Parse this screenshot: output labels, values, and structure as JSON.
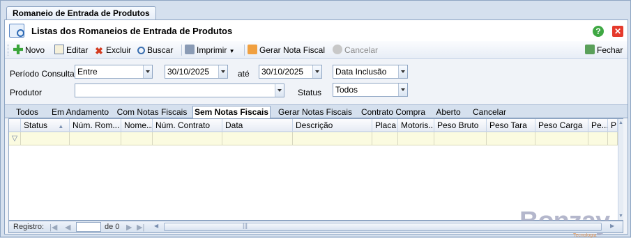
{
  "doc_tab": "Romaneio de Entrada de Produtos",
  "window": {
    "title": "Listas dos Romaneios de Entrada de Produtos"
  },
  "toolbar": {
    "novo": "Novo",
    "editar": "Editar",
    "excluir": "Excluir",
    "buscar": "Buscar",
    "imprimir": "Imprimir",
    "gerar_nota": "Gerar Nota Fiscal",
    "cancelar": "Cancelar",
    "fechar": "Fechar"
  },
  "filters": {
    "periodo_label": "Período Consulta",
    "periodo_mode": "Entre",
    "data_inicio": "30/10/2025",
    "ate_label": "até",
    "data_fim": "30/10/2025",
    "data_tipo": "Data Inclusão",
    "produtor_label": "Produtor",
    "produtor_value": "",
    "status_label": "Status",
    "status_value": "Todos"
  },
  "tabs": [
    "Todos",
    "Em Andamento",
    "Com Notas Fiscais",
    "Sem Notas Fiscais",
    "Gerar Notas Fiscais",
    "Contrato Compra",
    "Aberto",
    "Cancelar"
  ],
  "active_tab": "Sem Notas Fiscais",
  "columns": [
    "Status",
    "Núm. Rom...",
    "Nome...",
    "Núm. Contrato",
    "Data",
    "Descrição",
    "Placa",
    "Motoris...",
    "Peso Bruto",
    "Peso Tara",
    "Peso Carga",
    "Pe...",
    "P"
  ],
  "footer": {
    "registro_label": "Registro:",
    "de_label": "de 0"
  },
  "logo": {
    "text": "Bonzay",
    "sub": "Tecnologia"
  },
  "colors": {
    "accent": "#8ea5c3",
    "filter_row": "#fbfbe0"
  }
}
